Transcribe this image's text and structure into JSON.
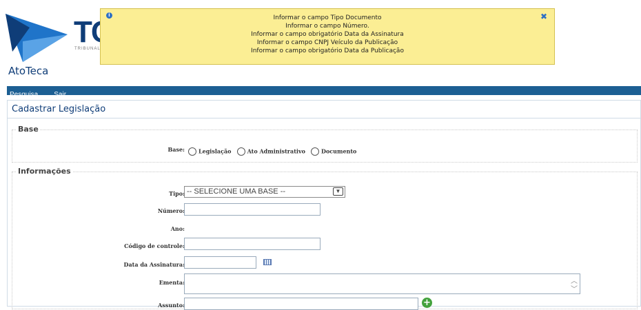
{
  "header": {
    "logo_text": "TC",
    "logo_subtitle": "TRIBUNAL",
    "app_name": "AtoTeca"
  },
  "messages": {
    "items": [
      "Informar o campo Tipo Documento",
      "Informar o campo Número.",
      "Informar o campo obrigatório Data da Assinatura",
      "Informar o campo CNPJ Veículo da Publicação",
      "Informar o campo obrigatório Data da Publicação"
    ],
    "icon": "info-icon",
    "close_icon": "close-icon"
  },
  "menu": {
    "items": [
      "Pesquisa",
      "Sair"
    ]
  },
  "page": {
    "title": "Cadastrar Legislação"
  },
  "base_section": {
    "legend": "Base",
    "label": "Base:",
    "options": [
      "Legislação",
      "Ato Administrativo",
      "Documento"
    ]
  },
  "info_section": {
    "legend": "Informações",
    "tipo_label": "Tipo:",
    "tipo_value": "-- SELECIONE UMA BASE --",
    "numero_label": "Número:",
    "ano_label": "Ano:",
    "codigo_label": "Código de controle:",
    "data_label": "Data da Assinatura:",
    "ementa_label": "Ementa:",
    "assunto_label": "Assunto:"
  },
  "colors": {
    "menubar": "#1c5f93",
    "message_bg": "#fbee94",
    "brand": "#0f3d78"
  }
}
